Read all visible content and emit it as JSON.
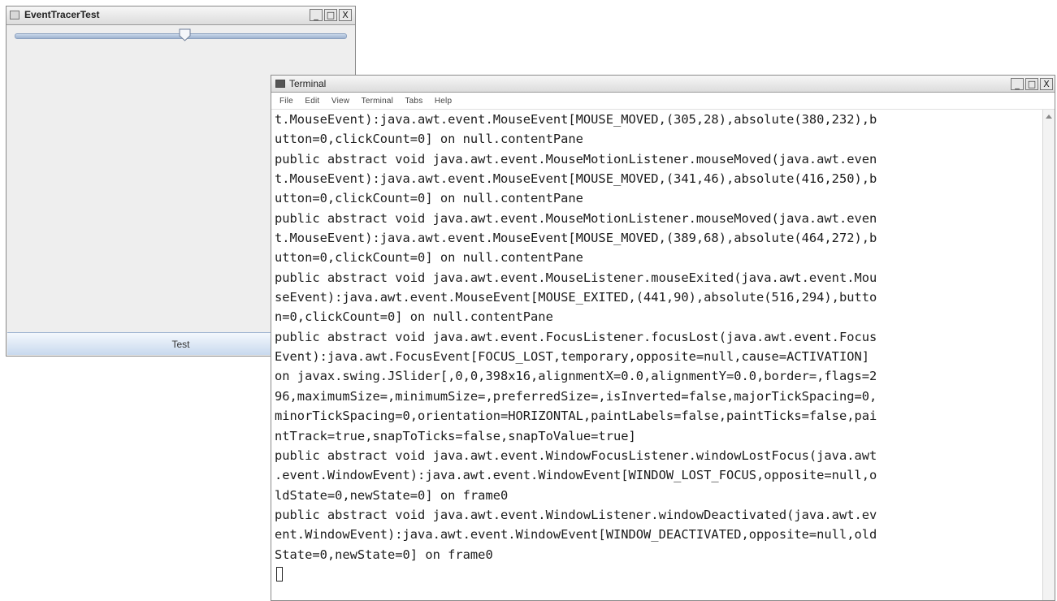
{
  "event_tracer": {
    "title": "EventTracerTest",
    "slider_value_fraction": 0.51,
    "button_label": "Test",
    "controls": {
      "minimize": "_",
      "maximize": "□",
      "close": "X"
    }
  },
  "terminal": {
    "title": "Terminal",
    "controls": {
      "minimize": "_",
      "maximize": "□",
      "close": "X"
    },
    "menu": [
      "File",
      "Edit",
      "View",
      "Terminal",
      "Tabs",
      "Help"
    ],
    "lines": [
      "t.MouseEvent):java.awt.event.MouseEvent[MOUSE_MOVED,(305,28),absolute(380,232),b",
      "utton=0,clickCount=0] on null.contentPane",
      "public abstract void java.awt.event.MouseMotionListener.mouseMoved(java.awt.even",
      "t.MouseEvent):java.awt.event.MouseEvent[MOUSE_MOVED,(341,46),absolute(416,250),b",
      "utton=0,clickCount=0] on null.contentPane",
      "public abstract void java.awt.event.MouseMotionListener.mouseMoved(java.awt.even",
      "t.MouseEvent):java.awt.event.MouseEvent[MOUSE_MOVED,(389,68),absolute(464,272),b",
      "utton=0,clickCount=0] on null.contentPane",
      "public abstract void java.awt.event.MouseListener.mouseExited(java.awt.event.Mou",
      "seEvent):java.awt.event.MouseEvent[MOUSE_EXITED,(441,90),absolute(516,294),butto",
      "n=0,clickCount=0] on null.contentPane",
      "public abstract void java.awt.event.FocusListener.focusLost(java.awt.event.Focus",
      "Event):java.awt.FocusEvent[FOCUS_LOST,temporary,opposite=null,cause=ACTIVATION]",
      "on javax.swing.JSlider[,0,0,398x16,alignmentX=0.0,alignmentY=0.0,border=,flags=2",
      "96,maximumSize=,minimumSize=,preferredSize=,isInverted=false,majorTickSpacing=0,",
      "minorTickSpacing=0,orientation=HORIZONTAL,paintLabels=false,paintTicks=false,pai",
      "ntTrack=true,snapToTicks=false,snapToValue=true]",
      "public abstract void java.awt.event.WindowFocusListener.windowLostFocus(java.awt",
      ".event.WindowEvent):java.awt.event.WindowEvent[WINDOW_LOST_FOCUS,opposite=null,o",
      "ldState=0,newState=0] on frame0",
      "public abstract void java.awt.event.WindowListener.windowDeactivated(java.awt.ev",
      "ent.WindowEvent):java.awt.event.WindowEvent[WINDOW_DEACTIVATED,opposite=null,old",
      "State=0,newState=0] on frame0"
    ]
  }
}
